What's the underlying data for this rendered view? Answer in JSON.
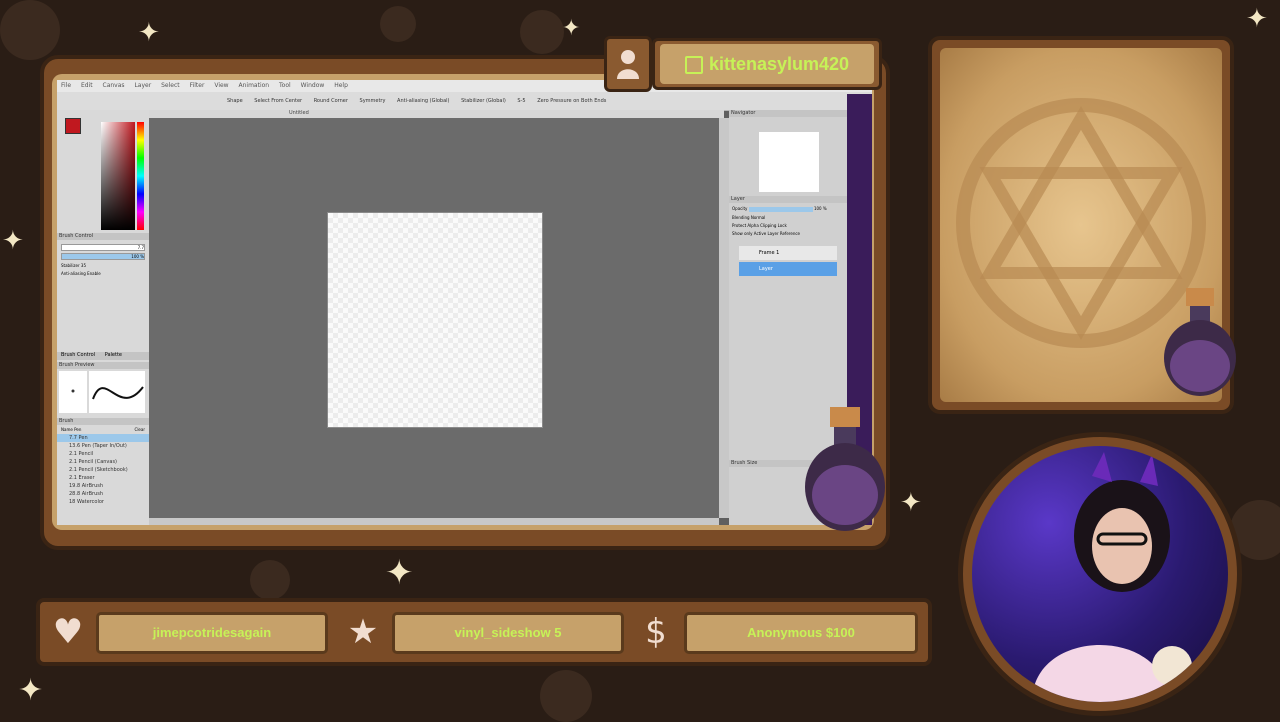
{
  "overlay": {
    "channel_name": "kittenasylum420",
    "follower": "jimepcotridesagain",
    "subscriber": "vinyl_sideshow 5",
    "donation": "Anonymous $100",
    "icons": [
      "twitch-icon",
      "heart-icon",
      "star-icon",
      "dollar-icon",
      "person-icon"
    ],
    "accent_color": "#c6f257",
    "frame_color": "#7a4b26"
  },
  "sai": {
    "menu": [
      "File",
      "Edit",
      "Canvas",
      "Layer",
      "Select",
      "Filter",
      "View",
      "Animation",
      "Tool",
      "Window",
      "Help"
    ],
    "toolbar": {
      "shape": "Shape",
      "select_from_center": "Select From Center",
      "round_corner": "Round Corner",
      "symmetry": "Symmetry",
      "anti_aliasing": "Anti-aliasing (Global)",
      "stabilizer": "Stabilizer (Global)",
      "stabilizer_value": "S-5",
      "zero_pressure": "Zero Pressure on Both Ends"
    },
    "document_tab": "Untitled",
    "left": {
      "brush_control_title": "Brush Control",
      "size_value": "7.7",
      "density_value": "100 %",
      "stabilizer_label": "Stabilizer",
      "stabilizer_value": "35",
      "anti_aliasing_label": "Anti-aliasing",
      "anti_aliasing_value": "Enable",
      "tabs": [
        "Brush Control",
        "Palette"
      ],
      "brush_preview_title": "Brush Preview",
      "brush_title": "Brush",
      "brush_name_label": "Name",
      "brush_name_value": "Pen",
      "clear_label": "Clear",
      "brushes": [
        {
          "size": "7.7",
          "name": "Pen"
        },
        {
          "size": "13.6",
          "name": "Pen (Taper In/Out)"
        },
        {
          "size": "2.1",
          "name": "Pencil"
        },
        {
          "size": "2.1",
          "name": "Pencil (Canvas)"
        },
        {
          "size": "2.1",
          "name": "Pencil (Sketchbook)"
        },
        {
          "size": "2.1",
          "name": "Eraser"
        },
        {
          "size": "19.8",
          "name": "AirBrush"
        },
        {
          "size": "28.8",
          "name": "AirBrush"
        },
        {
          "size": "18",
          "name": "Watercolor"
        }
      ]
    },
    "right": {
      "navigator_title": "Navigator",
      "layer_title": "Layer",
      "opacity_label": "Opacity",
      "opacity_value": "100 %",
      "blending_label": "Blending",
      "blending_value": "Normal",
      "protect_alpha": "Protect Alpha",
      "clipping": "Clipping",
      "lock": "Lock",
      "show_only_active": "Show only Active Layer",
      "reference": "Reference",
      "layers": [
        "Frame 1",
        "Layer"
      ],
      "brush_size_title": "Brush Size"
    }
  }
}
